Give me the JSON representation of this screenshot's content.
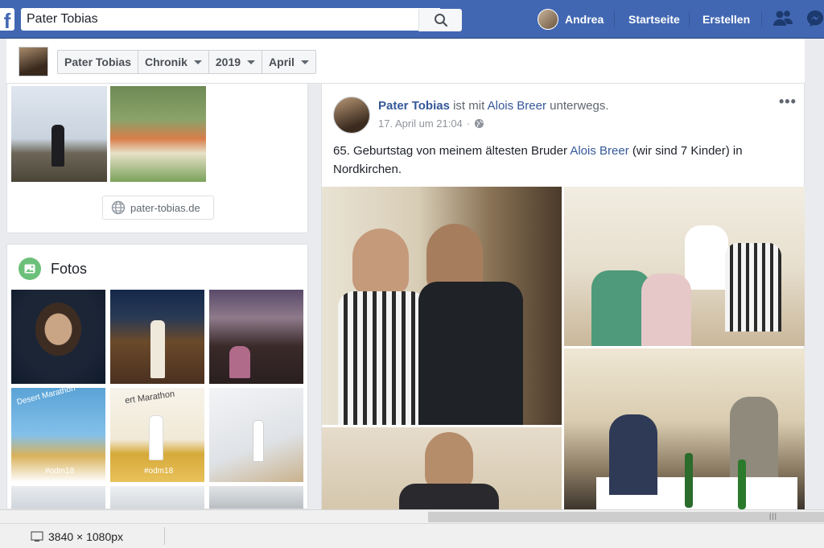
{
  "topbar": {
    "logo_letter": "f",
    "search_value": "Pater Tobias",
    "user_name": "Andrea",
    "home_label": "Startseite",
    "create_label": "Erstellen"
  },
  "subheader": {
    "crumbs": [
      {
        "label": "Pater Tobias"
      },
      {
        "label": "Chronik"
      },
      {
        "label": "2019"
      },
      {
        "label": "April"
      }
    ]
  },
  "intro": {
    "website": "pater-tobias.de"
  },
  "photos": {
    "title": "Fotos",
    "tag_a": "#odm18",
    "tag_b": "#odm18",
    "banner_a": "Desert Marathon",
    "banner_b": "ert Marathon"
  },
  "post": {
    "author": "Pater Tobias",
    "with_text": "ist mit",
    "companion": "Alois Breer",
    "activity": "unterwegs.",
    "timestamp": "17. April um 21:04",
    "text_before": "65. Geburtstag von meinem ältesten Bruder",
    "text_link": "Alois Breer",
    "text_after": "(wir sind 7 Kinder) in Nordkirchen.",
    "more_label": "•••"
  },
  "statusbar": {
    "dimensions": "3840 × 1080px",
    "grip": "|||"
  },
  "colors": {
    "brand": "#4267b2",
    "link": "#365899",
    "background": "#e9ebee"
  }
}
